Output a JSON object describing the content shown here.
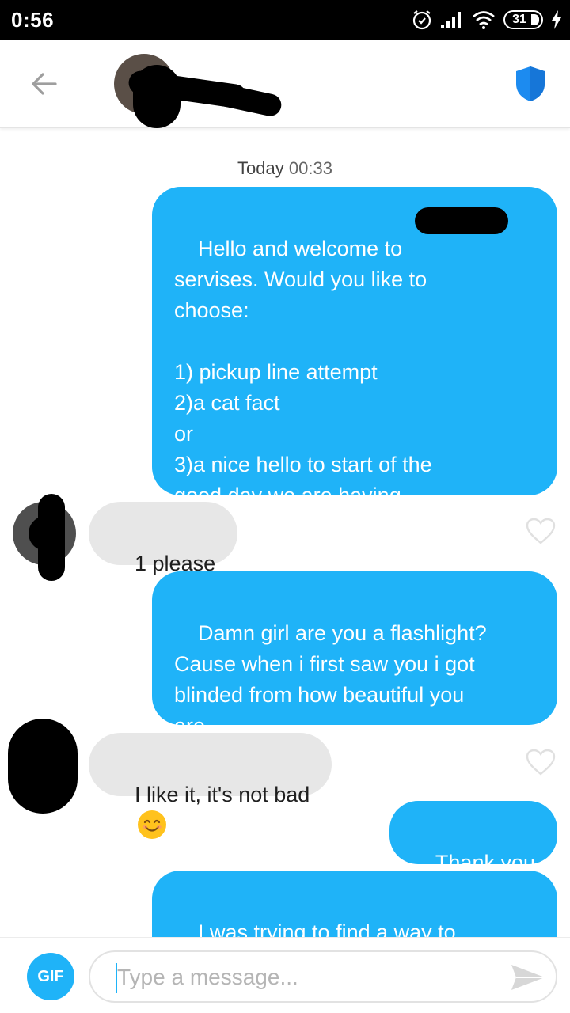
{
  "status_bar": {
    "time": "0:56",
    "battery": "31",
    "icons": [
      "alarm-icon",
      "signal-icon",
      "wifi-icon",
      "battery-icon",
      "charging-icon"
    ]
  },
  "header": {
    "back_icon": "arrow-left-icon",
    "shield_icon": "shield-icon",
    "accent_color": "#1c8bf0"
  },
  "chat": {
    "timestamp_day": "Today",
    "timestamp_time": "00:33",
    "messages": [
      {
        "from": "me",
        "text": "Hello and welcome to \nservises. Would you like to\nchoose:\n\n1) pickup line attempt\n2)a cat fact\nor\n3)a nice hello to start of the\ngood day we are having"
      },
      {
        "from": "them",
        "text": "1 please"
      },
      {
        "from": "me",
        "text": "Damn girl are you a flashlight?\nCause when i first saw you i got\nblinded from how beautiful you\nare"
      },
      {
        "from": "them",
        "text": "I like it, it's not bad",
        "emoji": "smiling-face-icon"
      },
      {
        "from": "me",
        "text": "Thank you"
      },
      {
        "from": "me",
        "text": "I was trying to find a way to\nmake a pickup line with your"
      }
    ],
    "sent_color": "#1fb3f8",
    "received_color": "#e7e7e7"
  },
  "composer": {
    "gif_label": "GIF",
    "placeholder": "Type a message...",
    "send_icon": "send-icon"
  }
}
